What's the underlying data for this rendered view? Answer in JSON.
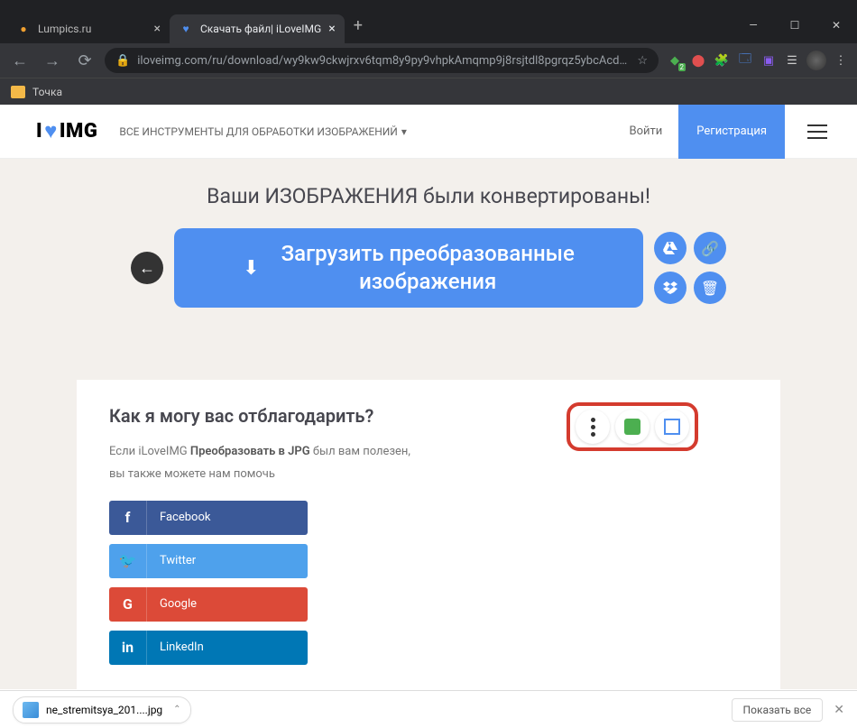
{
  "browser": {
    "tabs": [
      {
        "title": "Lumpics.ru",
        "active": false
      },
      {
        "title": "Скачать файл| iLoveIMG",
        "active": true
      }
    ],
    "url": "iloveimg.com/ru/download/wy9kw9ckwjrxv6tqm8y9py9vhpkAmqmp9j8rsjtdl8pgrqz5ybcAcdrk...",
    "bookmark": "Точка"
  },
  "logo": {
    "i": "I",
    "img": "IMG"
  },
  "nav": {
    "tools": "ВСЕ ИНСТРУМЕНТЫ ДЛЯ ОБРАБОТКИ ИЗОБРАЖЕНИЙ"
  },
  "auth": {
    "login": "Войти",
    "register": "Регистрация"
  },
  "hero": {
    "title": "Ваши ИЗОБРАЖЕНИЯ были конвертированы!"
  },
  "download": {
    "line1": "Загрузить преобразованные",
    "line2": "изображения"
  },
  "thanks": {
    "heading": "Как я могу вас отблагодарить?",
    "p1_a": "Если iLoveIMG ",
    "p1_b": "Преобразовать в JPG",
    "p1_c": " был вам полезен,",
    "p2": "вы также можете нам помочь"
  },
  "social": {
    "facebook": "Facebook",
    "twitter": "Twitter",
    "google": "Google",
    "linkedin": "LinkedIn"
  },
  "shelf": {
    "file": "ne_stremitsya_201....jpg",
    "showall": "Показать все"
  }
}
